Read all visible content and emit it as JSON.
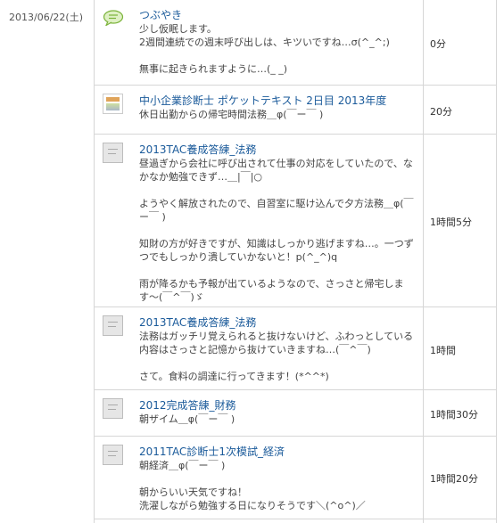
{
  "date": "2013/06/22(土)",
  "entries": [
    {
      "icon": "speech-bubble-icon",
      "title": "つぶやき",
      "body": "少し仮眠します。\n2週間連続での週末呼び出しは、キツいですね…σ(^_^;)\n\n無事に起きられますように…(_ _)",
      "duration": "0分"
    },
    {
      "icon": "book-cover-icon",
      "title": "中小企業診断士 ポケットテキスト 2日目 2013年度",
      "body": "休日出勤からの帰宅時間法務＿φ(￣ー￣ )",
      "duration": "20分"
    },
    {
      "icon": "book-thumbnail-icon",
      "title": "2013TAC養成答練_法務",
      "body": "昼過ぎから会社に呼び出されて仕事の対応をしていたので、なかなか勉強できず…＿|￣|○\n\nようやく解放されたので、自習室に駆け込んで夕方法務＿φ(￣ー￣ )\n\n知財の方が好きですが、知識はしっかり逃げますね…。一つずつでもしっかり潰していかないと！p(^_^)q\n\n雨が降るかも予報が出ているようなので、さっさと帰宅します〜(￣^￣)ゞ",
      "duration": "1時間5分"
    },
    {
      "icon": "book-thumbnail-icon",
      "title": "2013TAC養成答練_法務",
      "body": "法務はガッチリ覚えられると抜けないけど、ふわっとしている内容はさっさと記憶から抜けていきますね…(￣^￣)\n\nさて。食料の調達に行ってきます！(*^^*)",
      "duration": "1時間"
    },
    {
      "icon": "book-thumbnail-icon",
      "title": "2012完成答練_財務",
      "body": "朝ザイム＿φ(￣ー￣ )",
      "duration": "1時間30分"
    },
    {
      "icon": "book-thumbnail-icon",
      "title": "2011TAC診断士1次模試_経済",
      "body": "朝経済＿φ(￣ー￣ )\n\n朝からいい天気ですね！\n洗濯しながら勉強する日になりそうです＼(^o^)／",
      "duration": "1時間20分"
    }
  ]
}
